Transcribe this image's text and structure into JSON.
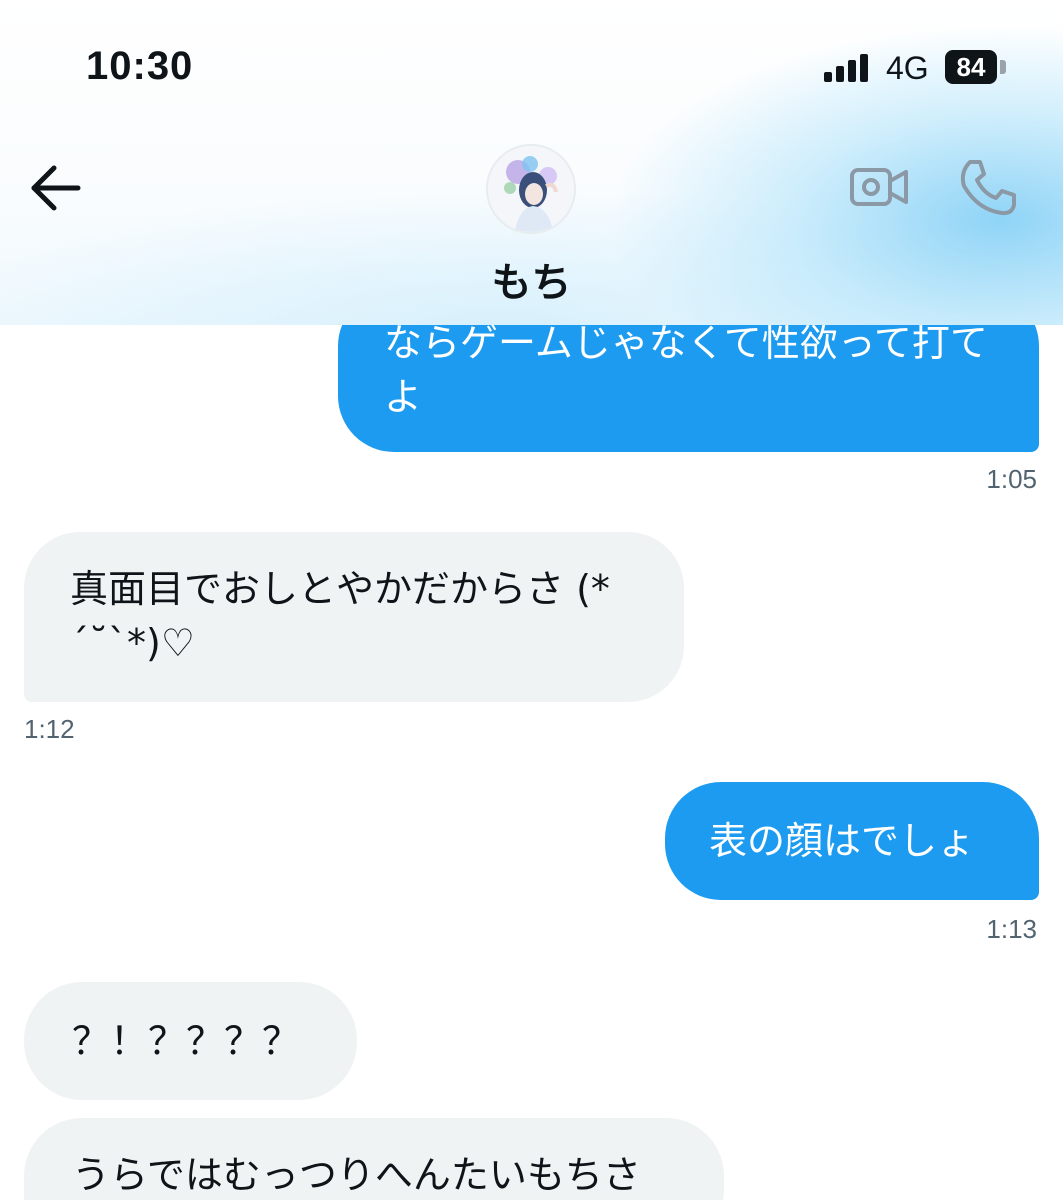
{
  "status_bar": {
    "time": "10:30",
    "network": "4G",
    "battery": "84"
  },
  "header": {
    "contact_name": "もち",
    "icons": {
      "back": "arrow-left-icon",
      "video": "video-camera-icon",
      "phone": "phone-icon"
    }
  },
  "messages": [
    {
      "direction": "outgoing",
      "text": "ならゲームじゃなくて性欲って打てよ",
      "time": "1:05"
    },
    {
      "direction": "incoming",
      "text": "真面目でおしとやかだからさ (*´˘`*)♡",
      "time": "1:12"
    },
    {
      "direction": "outgoing",
      "text": "表の顔はでしょ",
      "time": "1:13"
    },
    {
      "direction": "incoming",
      "text": "？！？？？？",
      "time": ""
    },
    {
      "direction": "incoming",
      "text": "うらではむっつりへんたいもちさ",
      "time": ""
    }
  ],
  "colors": {
    "outgoing_bubble": "#1d9bf0",
    "incoming_bubble": "#eff3f4",
    "timestamp": "#536471",
    "icon_gray": "#8b98a5"
  }
}
